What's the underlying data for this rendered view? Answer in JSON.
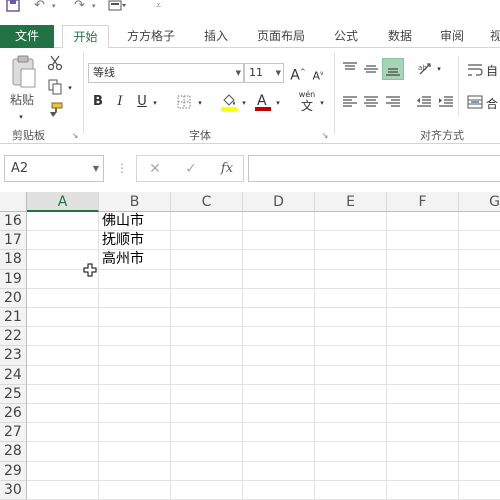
{
  "tabs": {
    "file": "文件",
    "home": "开始",
    "fangfang": "方方格子",
    "insert": "插入",
    "page_layout": "页面布局",
    "formulas": "公式",
    "data": "数据",
    "review": "审阅",
    "view_partial": "视"
  },
  "ribbon": {
    "paste_label": "粘贴",
    "clipboard_group": "剪贴板",
    "font_name": "等线",
    "font_size": "11",
    "font_group": "字体",
    "bold": "B",
    "italic": "I",
    "underline": "U",
    "wen_top": "wén",
    "wen_bottom": "文",
    "alignment_group": "对齐方式",
    "wrap_partial": "自",
    "merge_partial": "合"
  },
  "formula_bar": {
    "name_box": "A2",
    "fx": "fx",
    "formula_value": ""
  },
  "sheet": {
    "columns": [
      "A",
      "B",
      "C",
      "D",
      "E",
      "F",
      "G"
    ],
    "selected_column": "A",
    "rows": [
      "16",
      "17",
      "18",
      "19",
      "20",
      "21",
      "22",
      "23",
      "24",
      "25",
      "26",
      "27",
      "28",
      "29",
      "30"
    ],
    "cells": {
      "B16": "佛山市",
      "B17": "抚顺市",
      "B18": "高州市"
    }
  },
  "colors": {
    "accent": "#217346",
    "font_highlight": "#ffff00",
    "font_color": "#c00000"
  },
  "icons": [
    "save-icon",
    "undo-icon",
    "redo-icon",
    "customize-qat-icon",
    "paste-icon",
    "cut-icon",
    "copy-icon",
    "format-painter-icon",
    "fill-color-icon",
    "font-color-icon",
    "border-icon",
    "cancel-icon",
    "enter-icon",
    "fx-icon",
    "move-cursor-icon"
  ]
}
